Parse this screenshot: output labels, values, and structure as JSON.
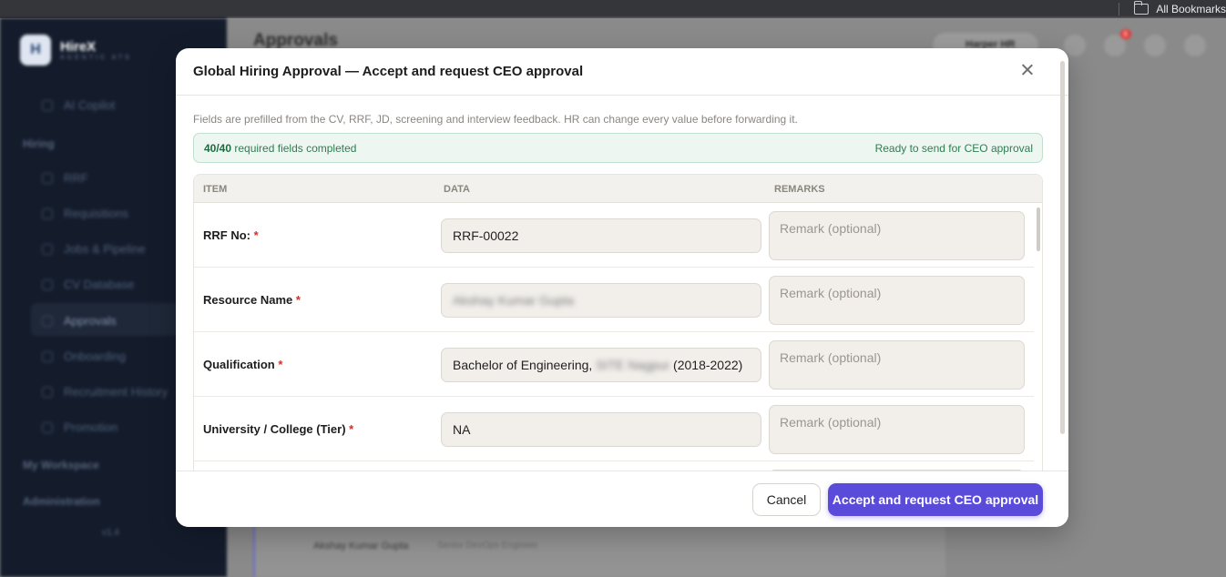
{
  "browser": {
    "bookmarks_label": "All Bookmarks"
  },
  "app": {
    "brand": "HireX",
    "brand_sub": "AGENTIC ATS",
    "page_title": "Approvals",
    "sidebar": {
      "copilot": "AI Copilot",
      "section_hiring": "Hiring",
      "items": [
        "RRF",
        "Requisitions",
        "Jobs & Pipeline",
        "CV Database",
        "Approvals",
        "Onboarding",
        "Recruitment History",
        "Promotion"
      ],
      "section_workspace": "My Workspace",
      "section_admin": "Administration",
      "version": "v1.4"
    },
    "user": "Harper HR",
    "notification_count": "6",
    "bg_candidate": "Akshay Kumar Gupta",
    "bg_role": "Senior DevOps Engineer"
  },
  "modal": {
    "title": "Global Hiring Approval — Accept and request CEO approval",
    "description": "Fields are prefilled from the CV, RRF, JD, screening and interview feedback. HR can change every value before forwarding it.",
    "status": {
      "completed": "40/40",
      "completed_text": "required fields completed",
      "ready": "Ready to send for CEO approval"
    },
    "columns": {
      "item": "ITEM",
      "data": "DATA",
      "remarks": "REMARKS"
    },
    "remark_placeholder": "Remark (optional)",
    "rows": [
      {
        "label": "RRF No:",
        "required": "*",
        "value": "RRF-00022"
      },
      {
        "label": "Resource Name",
        "required": "*",
        "value": "Akshay Kumar Gupta"
      },
      {
        "label": "Qualification",
        "required": "*",
        "value_prefix": "Bachelor of Engineering,",
        "value_hidden": "SITE Nagpur",
        "value_suffix": "(2018-2022)"
      },
      {
        "label": "University / College (Tier)",
        "required": "*",
        "value": "NA"
      }
    ],
    "buttons": {
      "cancel": "Cancel",
      "accept": "Accept and request CEO approval"
    }
  },
  "colors": {
    "accent": "#5b4bdb",
    "success": "#2f7d51",
    "required": "#d32f2f"
  }
}
